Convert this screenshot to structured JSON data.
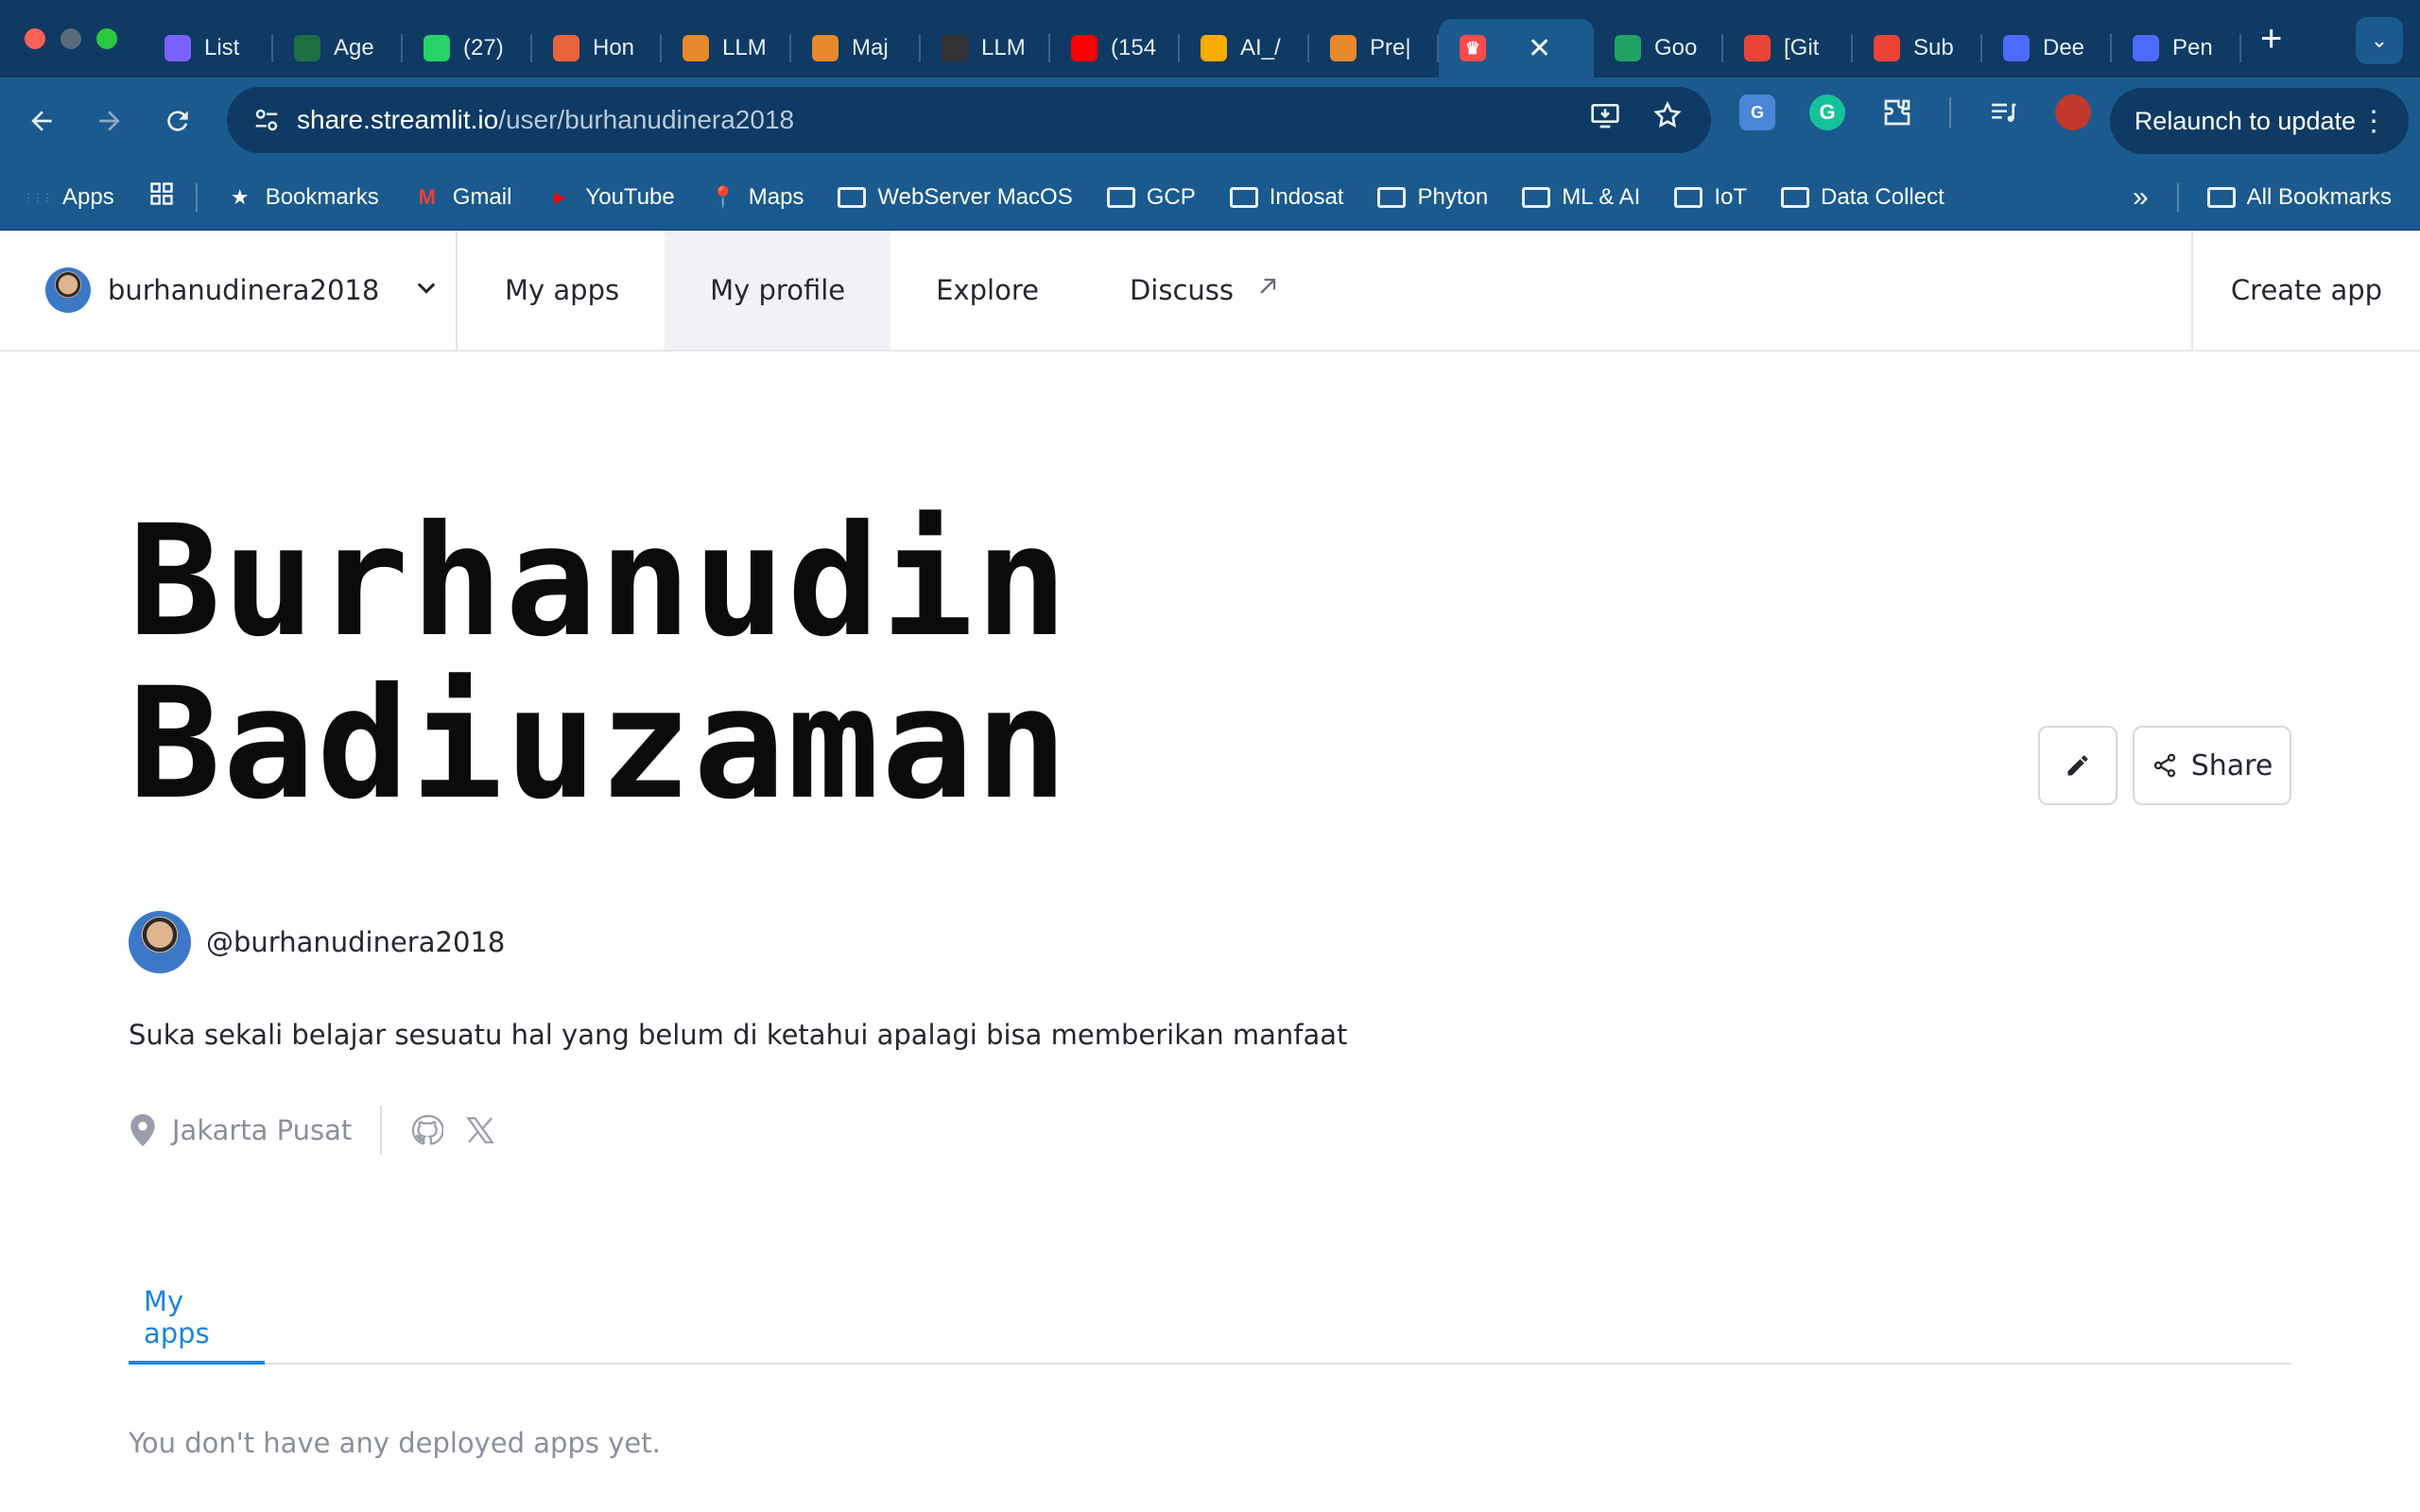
{
  "browser": {
    "tabs": [
      {
        "title": "List",
        "icon": "copilot-icon",
        "color": "#7b61ff"
      },
      {
        "title": "Age",
        "icon": "excel-icon",
        "color": "#1d6f42"
      },
      {
        "title": "(27)",
        "icon": "whatsapp-icon",
        "color": "#25d366"
      },
      {
        "title": "Hon",
        "icon": "hon-icon",
        "color": "#e8643c"
      },
      {
        "title": "LLM",
        "icon": "book-icon",
        "color": "#e8892c"
      },
      {
        "title": "Maj",
        "icon": "book-icon",
        "color": "#e8892c"
      },
      {
        "title": "LLM",
        "icon": "rocket-icon",
        "color": "#333333"
      },
      {
        "title": "(154",
        "icon": "youtube-icon",
        "color": "#ff0000"
      },
      {
        "title": "AI_/",
        "icon": "colab-icon",
        "color": "#f9ab00"
      },
      {
        "title": "Pre|",
        "icon": "book-icon",
        "color": "#e8892c"
      }
    ],
    "active_tab": {
      "icon": "streamlit-icon",
      "color": "#ff4b4b",
      "close": "✕"
    },
    "tabs_after": [
      {
        "title": "Goo",
        "icon": "drive-icon",
        "color": "#1fa463"
      },
      {
        "title": "[Git",
        "icon": "gmail-icon",
        "color": "#ea4335"
      },
      {
        "title": "Sub",
        "icon": "gmail-icon",
        "color": "#ea4335"
      },
      {
        "title": "Dee",
        "icon": "deepseek-icon",
        "color": "#4d6bfe"
      },
      {
        "title": "Pen",
        "icon": "deepseek-icon",
        "color": "#4d6bfe"
      }
    ],
    "url_host": "share.streamlit.io",
    "url_path": "/user/burhanudinera2018",
    "relaunch": "Relaunch to update",
    "bookmarks": [
      {
        "label": "Apps",
        "icon": "apps-grid-icon"
      },
      {
        "label": "Bookmarks",
        "icon": "star-icon"
      },
      {
        "label": "Gmail",
        "icon": "gmail-icon"
      },
      {
        "label": "YouTube",
        "icon": "youtube-icon"
      },
      {
        "label": "Maps",
        "icon": "maps-icon"
      },
      {
        "label": "WebServer MacOS",
        "icon": "folder-icon"
      },
      {
        "label": "GCP",
        "icon": "folder-icon"
      },
      {
        "label": "Indosat",
        "icon": "folder-icon"
      },
      {
        "label": "Phyton",
        "icon": "folder-icon"
      },
      {
        "label": "ML & AI",
        "icon": "folder-icon"
      },
      {
        "label": "IoT",
        "icon": "folder-icon"
      },
      {
        "label": "Data Collect",
        "icon": "folder-icon"
      }
    ],
    "all_bookmarks": "All Bookmarks",
    "overflow": "»"
  },
  "nav": {
    "username": "burhanudinera2018",
    "links": [
      "My apps",
      "My profile",
      "Explore",
      "Discuss"
    ],
    "active": "My profile",
    "create_app": "Create app"
  },
  "profile": {
    "name_line1": "Burhanudin",
    "name_line2": "Badiuzaman",
    "handle": "@burhanudinera2018",
    "bio": "Suka sekali belajar sesuatu hal yang belum di ketahui apalagi bisa memberikan manfaat",
    "location": "Jakarta Pusat",
    "share_label": "Share"
  },
  "apps_section": {
    "tab_label": "My apps",
    "empty_message": "You don't have any deployed apps yet."
  }
}
